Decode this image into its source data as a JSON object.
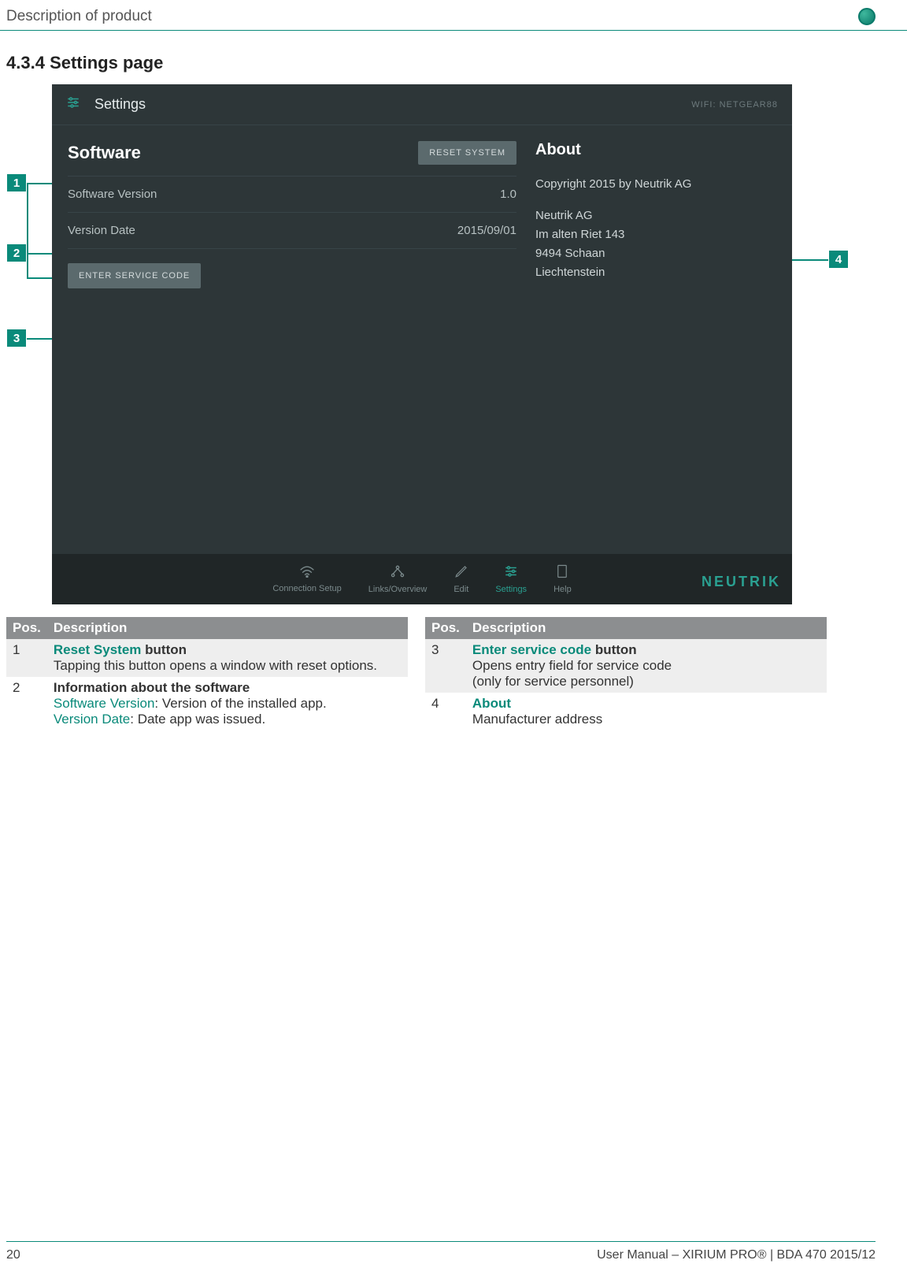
{
  "header": {
    "breadcrumb": "Description of product"
  },
  "section": {
    "number": "4.3.4",
    "title": "Settings page"
  },
  "screenshot": {
    "header": {
      "title": "Settings",
      "wifi_label": "WIFI: NETGEAR88"
    },
    "software": {
      "title": "Software",
      "reset_button": "RESET SYSTEM",
      "rows": [
        {
          "label": "Software Version",
          "value": "1.0"
        },
        {
          "label": "Version Date",
          "value": "2015/09/01"
        }
      ],
      "service_button": "ENTER SERVICE CODE"
    },
    "about": {
      "title": "About",
      "copyright": "Copyright 2015 by Neutrik AG",
      "company": "Neutrik AG",
      "addr1": "Im alten Riet 143",
      "addr2": "9494 Schaan",
      "country": "Liechtenstein"
    },
    "nav": {
      "items": [
        {
          "label": "Connection Setup"
        },
        {
          "label": "Links/Overview"
        },
        {
          "label": "Edit"
        },
        {
          "label": "Settings"
        },
        {
          "label": "Help"
        }
      ],
      "brand": "NEUTRIK"
    }
  },
  "callouts": {
    "c1": "1",
    "c2": "2",
    "c3": "3",
    "c4": "4"
  },
  "tables": {
    "left": {
      "headers": {
        "pos": "Pos.",
        "desc": "Description"
      },
      "rows": [
        {
          "pos": "1",
          "title_teal": "Reset System",
          "title_rest": " button",
          "body": "Tapping this button opens a window with reset options."
        },
        {
          "pos": "2",
          "title_bold": "Information about the software",
          "l1_teal": "Software Version",
          "l1_rest": ": Version of the installed app.",
          "l2_teal": "Version Date",
          "l2_rest": ": Date app was issued."
        }
      ]
    },
    "right": {
      "headers": {
        "pos": "Pos.",
        "desc": "Description"
      },
      "rows": [
        {
          "pos": "3",
          "title_teal": "Enter service code",
          "title_rest": " button",
          "body1": "Opens entry field for service code",
          "body2": "(only for service personnel)"
        },
        {
          "pos": "4",
          "title_teal": "About",
          "body": "Manufacturer address"
        }
      ]
    }
  },
  "footer": {
    "page": "20",
    "doc": "User Manual – XIRIUM PRO® | BDA 470 2015/12"
  }
}
